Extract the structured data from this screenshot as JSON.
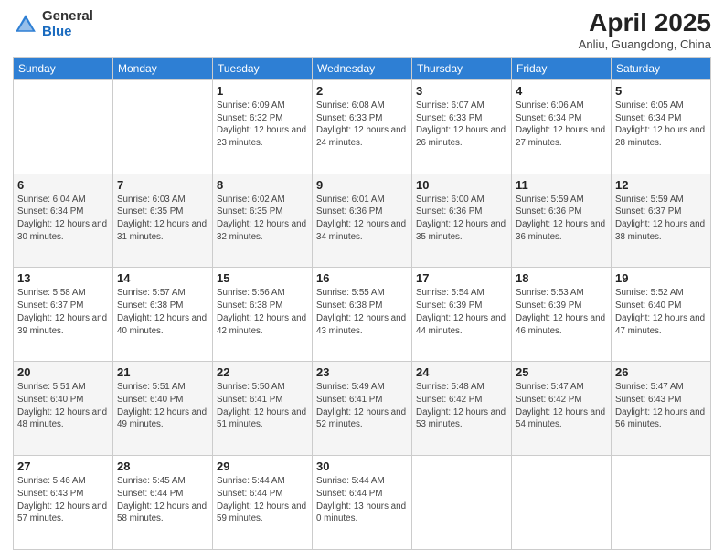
{
  "header": {
    "logo_general": "General",
    "logo_blue": "Blue",
    "title": "April 2025",
    "location": "Anliu, Guangdong, China"
  },
  "weekdays": [
    "Sunday",
    "Monday",
    "Tuesday",
    "Wednesday",
    "Thursday",
    "Friday",
    "Saturday"
  ],
  "weeks": [
    [
      {
        "day": "",
        "sunrise": "",
        "sunset": "",
        "daylight": ""
      },
      {
        "day": "",
        "sunrise": "",
        "sunset": "",
        "daylight": ""
      },
      {
        "day": "1",
        "sunrise": "Sunrise: 6:09 AM",
        "sunset": "Sunset: 6:32 PM",
        "daylight": "Daylight: 12 hours and 23 minutes."
      },
      {
        "day": "2",
        "sunrise": "Sunrise: 6:08 AM",
        "sunset": "Sunset: 6:33 PM",
        "daylight": "Daylight: 12 hours and 24 minutes."
      },
      {
        "day": "3",
        "sunrise": "Sunrise: 6:07 AM",
        "sunset": "Sunset: 6:33 PM",
        "daylight": "Daylight: 12 hours and 26 minutes."
      },
      {
        "day": "4",
        "sunrise": "Sunrise: 6:06 AM",
        "sunset": "Sunset: 6:34 PM",
        "daylight": "Daylight: 12 hours and 27 minutes."
      },
      {
        "day": "5",
        "sunrise": "Sunrise: 6:05 AM",
        "sunset": "Sunset: 6:34 PM",
        "daylight": "Daylight: 12 hours and 28 minutes."
      }
    ],
    [
      {
        "day": "6",
        "sunrise": "Sunrise: 6:04 AM",
        "sunset": "Sunset: 6:34 PM",
        "daylight": "Daylight: 12 hours and 30 minutes."
      },
      {
        "day": "7",
        "sunrise": "Sunrise: 6:03 AM",
        "sunset": "Sunset: 6:35 PM",
        "daylight": "Daylight: 12 hours and 31 minutes."
      },
      {
        "day": "8",
        "sunrise": "Sunrise: 6:02 AM",
        "sunset": "Sunset: 6:35 PM",
        "daylight": "Daylight: 12 hours and 32 minutes."
      },
      {
        "day": "9",
        "sunrise": "Sunrise: 6:01 AM",
        "sunset": "Sunset: 6:36 PM",
        "daylight": "Daylight: 12 hours and 34 minutes."
      },
      {
        "day": "10",
        "sunrise": "Sunrise: 6:00 AM",
        "sunset": "Sunset: 6:36 PM",
        "daylight": "Daylight: 12 hours and 35 minutes."
      },
      {
        "day": "11",
        "sunrise": "Sunrise: 5:59 AM",
        "sunset": "Sunset: 6:36 PM",
        "daylight": "Daylight: 12 hours and 36 minutes."
      },
      {
        "day": "12",
        "sunrise": "Sunrise: 5:59 AM",
        "sunset": "Sunset: 6:37 PM",
        "daylight": "Daylight: 12 hours and 38 minutes."
      }
    ],
    [
      {
        "day": "13",
        "sunrise": "Sunrise: 5:58 AM",
        "sunset": "Sunset: 6:37 PM",
        "daylight": "Daylight: 12 hours and 39 minutes."
      },
      {
        "day": "14",
        "sunrise": "Sunrise: 5:57 AM",
        "sunset": "Sunset: 6:38 PM",
        "daylight": "Daylight: 12 hours and 40 minutes."
      },
      {
        "day": "15",
        "sunrise": "Sunrise: 5:56 AM",
        "sunset": "Sunset: 6:38 PM",
        "daylight": "Daylight: 12 hours and 42 minutes."
      },
      {
        "day": "16",
        "sunrise": "Sunrise: 5:55 AM",
        "sunset": "Sunset: 6:38 PM",
        "daylight": "Daylight: 12 hours and 43 minutes."
      },
      {
        "day": "17",
        "sunrise": "Sunrise: 5:54 AM",
        "sunset": "Sunset: 6:39 PM",
        "daylight": "Daylight: 12 hours and 44 minutes."
      },
      {
        "day": "18",
        "sunrise": "Sunrise: 5:53 AM",
        "sunset": "Sunset: 6:39 PM",
        "daylight": "Daylight: 12 hours and 46 minutes."
      },
      {
        "day": "19",
        "sunrise": "Sunrise: 5:52 AM",
        "sunset": "Sunset: 6:40 PM",
        "daylight": "Daylight: 12 hours and 47 minutes."
      }
    ],
    [
      {
        "day": "20",
        "sunrise": "Sunrise: 5:51 AM",
        "sunset": "Sunset: 6:40 PM",
        "daylight": "Daylight: 12 hours and 48 minutes."
      },
      {
        "day": "21",
        "sunrise": "Sunrise: 5:51 AM",
        "sunset": "Sunset: 6:40 PM",
        "daylight": "Daylight: 12 hours and 49 minutes."
      },
      {
        "day": "22",
        "sunrise": "Sunrise: 5:50 AM",
        "sunset": "Sunset: 6:41 PM",
        "daylight": "Daylight: 12 hours and 51 minutes."
      },
      {
        "day": "23",
        "sunrise": "Sunrise: 5:49 AM",
        "sunset": "Sunset: 6:41 PM",
        "daylight": "Daylight: 12 hours and 52 minutes."
      },
      {
        "day": "24",
        "sunrise": "Sunrise: 5:48 AM",
        "sunset": "Sunset: 6:42 PM",
        "daylight": "Daylight: 12 hours and 53 minutes."
      },
      {
        "day": "25",
        "sunrise": "Sunrise: 5:47 AM",
        "sunset": "Sunset: 6:42 PM",
        "daylight": "Daylight: 12 hours and 54 minutes."
      },
      {
        "day": "26",
        "sunrise": "Sunrise: 5:47 AM",
        "sunset": "Sunset: 6:43 PM",
        "daylight": "Daylight: 12 hours and 56 minutes."
      }
    ],
    [
      {
        "day": "27",
        "sunrise": "Sunrise: 5:46 AM",
        "sunset": "Sunset: 6:43 PM",
        "daylight": "Daylight: 12 hours and 57 minutes."
      },
      {
        "day": "28",
        "sunrise": "Sunrise: 5:45 AM",
        "sunset": "Sunset: 6:44 PM",
        "daylight": "Daylight: 12 hours and 58 minutes."
      },
      {
        "day": "29",
        "sunrise": "Sunrise: 5:44 AM",
        "sunset": "Sunset: 6:44 PM",
        "daylight": "Daylight: 12 hours and 59 minutes."
      },
      {
        "day": "30",
        "sunrise": "Sunrise: 5:44 AM",
        "sunset": "Sunset: 6:44 PM",
        "daylight": "Daylight: 13 hours and 0 minutes."
      },
      {
        "day": "",
        "sunrise": "",
        "sunset": "",
        "daylight": ""
      },
      {
        "day": "",
        "sunrise": "",
        "sunset": "",
        "daylight": ""
      },
      {
        "day": "",
        "sunrise": "",
        "sunset": "",
        "daylight": ""
      }
    ]
  ]
}
